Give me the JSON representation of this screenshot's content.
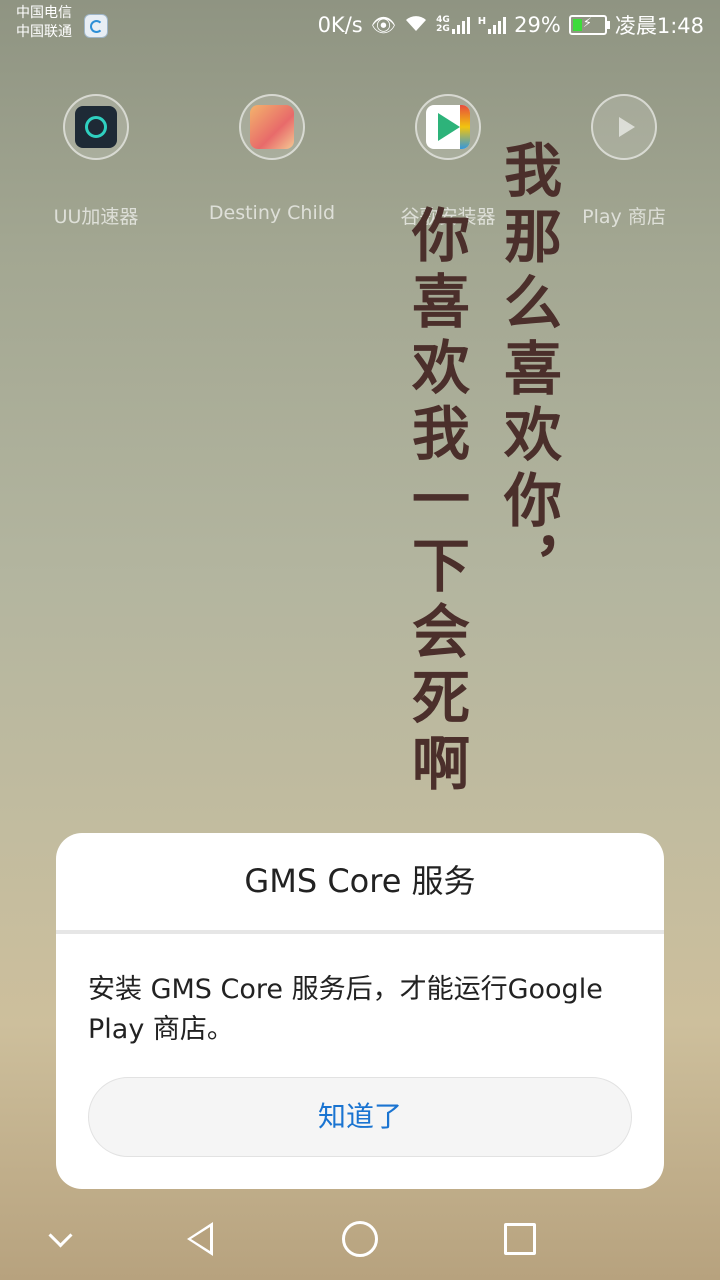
{
  "status_bar": {
    "carrier_1": "中国电信",
    "carrier_2": "中国联通",
    "net_speed": "0K/s",
    "network_1": "4G",
    "network_2": "2G",
    "network_3": "H",
    "battery": "29%",
    "time": "凌晨1:48"
  },
  "apps": [
    {
      "label": "UU加速器",
      "icon": "uu-accelerator-icon"
    },
    {
      "label": "Destiny Child",
      "icon": "destiny-child-icon"
    },
    {
      "label": "谷歌安装器",
      "icon": "google-installer-icon"
    },
    {
      "label": "Play 商店",
      "icon": "play-store-icon"
    }
  ],
  "wallpaper": {
    "line_1": "我那么喜欢你，",
    "line_2": "你喜欢我一下会死啊"
  },
  "dialog": {
    "title": "GMS Core 服务",
    "message": "安装 GMS Core 服务后，才能运行Google Play 商店。",
    "button": "知道了"
  },
  "colors": {
    "accent": "#1a74d1",
    "battery_fill": "#3ddc3a"
  }
}
